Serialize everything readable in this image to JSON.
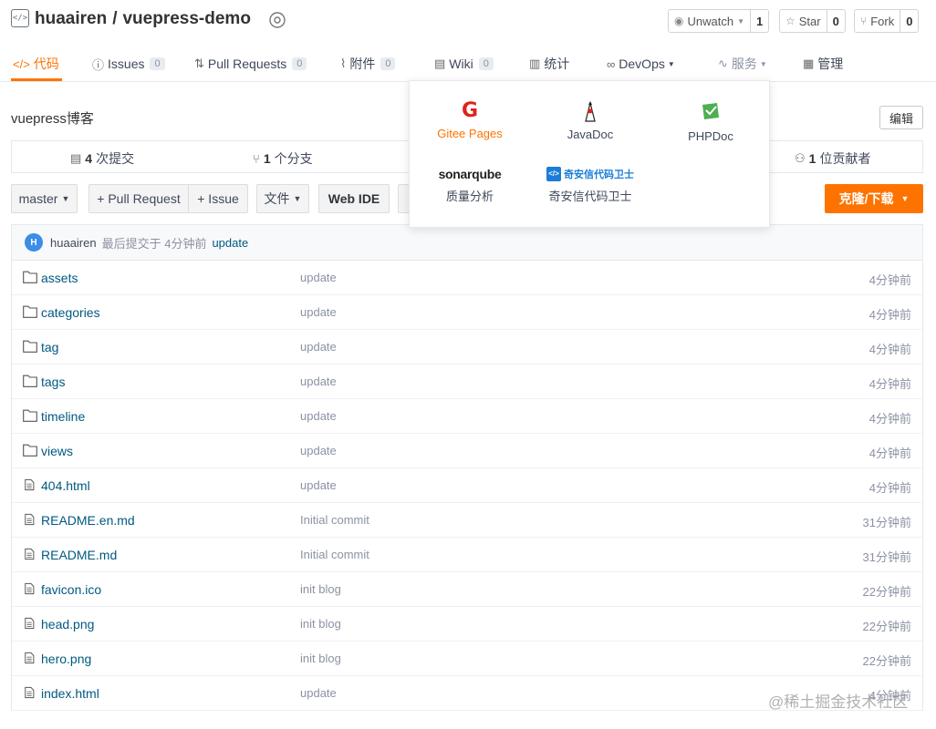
{
  "repo": {
    "owner": "huaairen",
    "separator": "/",
    "name": "vuepress-demo",
    "description": "vuepress博客",
    "edit_label": "编辑"
  },
  "header_buttons": {
    "watch": {
      "label": "Unwatch",
      "count": "1"
    },
    "star": {
      "label": "Star",
      "count": "0"
    },
    "fork": {
      "label": "Fork",
      "count": "0"
    }
  },
  "tabs": [
    {
      "label": "代码",
      "icon": "code-icon",
      "badge": ""
    },
    {
      "label": "Issues",
      "icon": "issue-icon",
      "badge": "0"
    },
    {
      "label": "Pull Requests",
      "icon": "pull-request-icon",
      "badge": "0"
    },
    {
      "label": "附件",
      "icon": "attachment-icon",
      "badge": "0"
    },
    {
      "label": "Wiki",
      "icon": "wiki-icon",
      "badge": "0"
    },
    {
      "label": "统计",
      "icon": "stats-icon",
      "badge": ""
    },
    {
      "label": "DevOps",
      "icon": "devops-icon",
      "badge": ""
    },
    {
      "label": "服务",
      "icon": "service-icon",
      "badge": ""
    },
    {
      "label": "管理",
      "icon": "manage-icon",
      "badge": ""
    }
  ],
  "stats": {
    "commits": {
      "count": "4",
      "label": "次提交"
    },
    "branches": {
      "count": "1",
      "label": "个分支"
    },
    "contributors": {
      "count": "1",
      "label": "位贡献者"
    }
  },
  "actions": {
    "branch": "master",
    "pull_request": "+ Pull Request",
    "issue": "+ Issue",
    "file": "文件",
    "web_ide": "Web IDE",
    "clone": "克隆/下载"
  },
  "last_commit": {
    "avatar_letter": "H",
    "author": "huaairen",
    "meta": "最后提交于 4分钟前",
    "message": "update"
  },
  "files": [
    {
      "name": "assets",
      "type": "folder",
      "message": "update",
      "time": "4分钟前"
    },
    {
      "name": "categories",
      "type": "folder",
      "message": "update",
      "time": "4分钟前"
    },
    {
      "name": "tag",
      "type": "folder",
      "message": "update",
      "time": "4分钟前"
    },
    {
      "name": "tags",
      "type": "folder",
      "message": "update",
      "time": "4分钟前"
    },
    {
      "name": "timeline",
      "type": "folder",
      "message": "update",
      "time": "4分钟前"
    },
    {
      "name": "views",
      "type": "folder",
      "message": "update",
      "time": "4分钟前"
    },
    {
      "name": "404.html",
      "type": "file",
      "message": "update",
      "time": "4分钟前"
    },
    {
      "name": "README.en.md",
      "type": "file",
      "message": "Initial commit",
      "time": "31分钟前"
    },
    {
      "name": "README.md",
      "type": "file",
      "message": "Initial commit",
      "time": "31分钟前"
    },
    {
      "name": "favicon.ico",
      "type": "file",
      "message": "init blog",
      "time": "22分钟前"
    },
    {
      "name": "head.png",
      "type": "file",
      "message": "init blog",
      "time": "22分钟前"
    },
    {
      "name": "hero.png",
      "type": "file",
      "message": "init blog",
      "time": "22分钟前"
    },
    {
      "name": "index.html",
      "type": "file",
      "message": "update",
      "time": "4分钟前"
    }
  ],
  "services_menu": {
    "gitee_pages": "Gitee Pages",
    "javadoc": "JavaDoc",
    "phpdoc": "PHPDoc",
    "sonar_logo": "sonarqube",
    "quality": "质量分析",
    "qax_logo": "奇安信代码卫士",
    "qax": "奇安信代码卫士"
  },
  "watermark": "@稀土掘金技术社区",
  "colors": {
    "accent": "#fe7300",
    "link": "#005980",
    "muted": "#8c92a4"
  }
}
